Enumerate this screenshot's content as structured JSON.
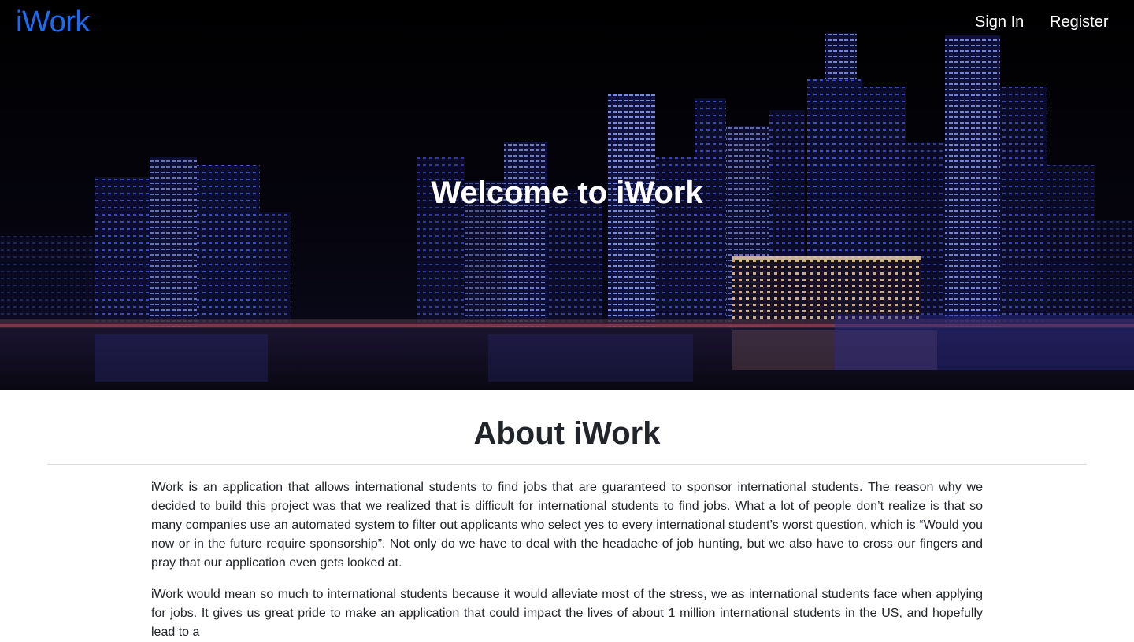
{
  "navbar": {
    "brand": "iWork",
    "sign_in": "Sign In",
    "register": "Register"
  },
  "hero": {
    "title": "Welcome to iWork"
  },
  "about": {
    "title": "About iWork",
    "paragraphs": [
      "iWork is an application that allows international students to find jobs that are guaranteed to sponsor international students. The reason why we decided to build this project was that we realized that is difficult for international students to find jobs. What a lot of people don’t realize is that so many companies use an automated system to filter out applicants who select yes to every international student’s worst question, which is “Would you now or in the future require sponsorship”. Not only do we have to deal with the headache of job hunting, but we also have to cross our fingers and pray that our application even gets looked at.",
      "iWork would mean so much to international students because it would alleviate most of the stress, we as international students face when applying for jobs. It gives us great pride to make an application that could impact the lives of about 1 million international students in the US, and hopefully lead to a"
    ]
  },
  "colors": {
    "brand": "#1a6cf0",
    "nav_text": "#ffffff",
    "heading": "#212529"
  }
}
